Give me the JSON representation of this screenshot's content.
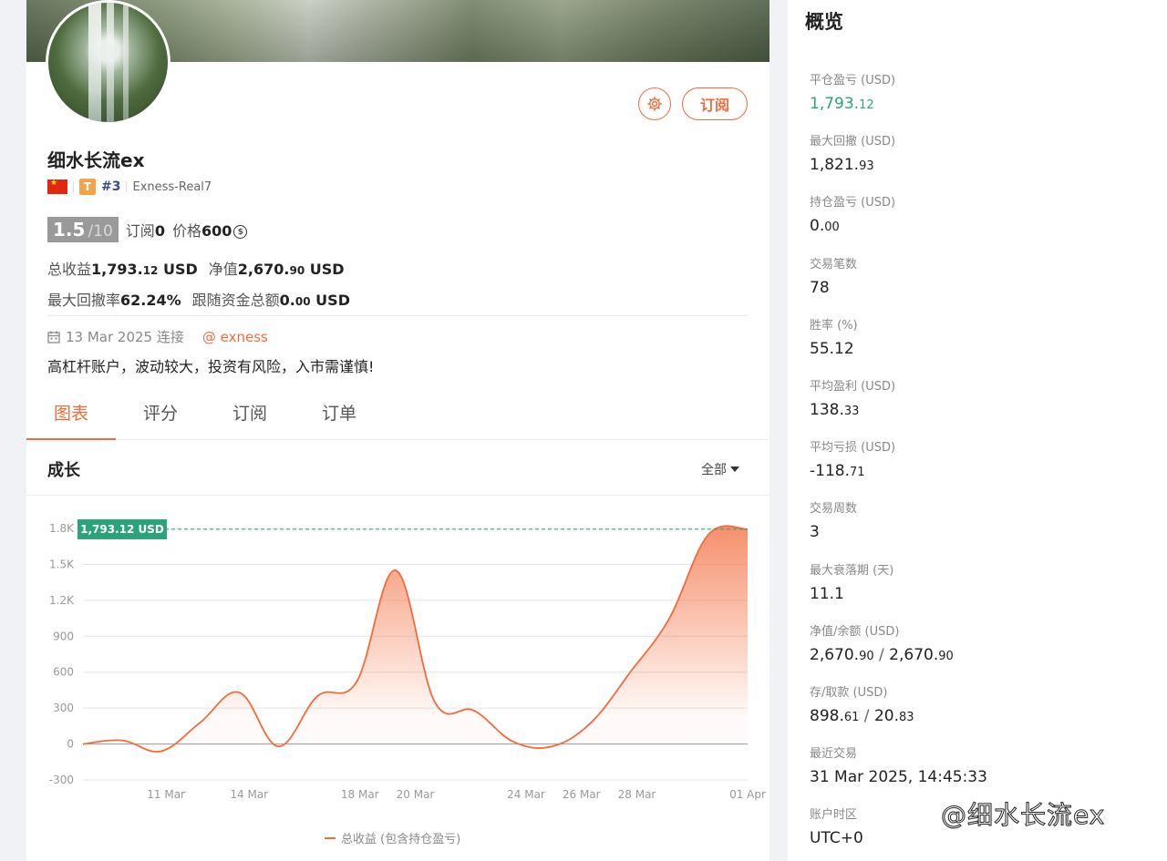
{
  "profile": {
    "name": "细水长流ex",
    "tier_letter": "T",
    "rank": "#3",
    "server": "Exness-Real7",
    "subscribe_label": "订阅",
    "rating_value": "1.5",
    "rating_max": "/10",
    "subs_label": "订阅",
    "subs_count": "0",
    "price_label": "价格",
    "price_value": "600",
    "price_currency_icon": "coin-icon",
    "total_profit_label": "总收益",
    "total_profit_int": "1,793.",
    "total_profit_dec": "12",
    "total_profit_unit": "USD",
    "equity_label": "净值",
    "equity_int": "2,670.",
    "equity_dec": "90",
    "equity_unit": "USD",
    "max_dd_label": "最大回撤率",
    "max_dd_value": "62.24%",
    "follow_funds_label": "跟随资金总额",
    "follow_funds_int": "0.",
    "follow_funds_dec": "00",
    "follow_funds_unit": "USD",
    "connected_date": "13 Mar 2025 连接",
    "broker_link": "@ exness",
    "bio": "高杠杆账户，波动较大，投资有风险，入市需谨慎!"
  },
  "tabs": [
    {
      "label": "图表",
      "active": true
    },
    {
      "label": "评分",
      "active": false
    },
    {
      "label": "订阅",
      "active": false
    },
    {
      "label": "订单",
      "active": false
    }
  ],
  "section": {
    "title": "成长",
    "range_label": "全部"
  },
  "chart_data": {
    "type": "area",
    "title": "成长",
    "x": [
      "08 Mar",
      "09 Mar",
      "10 Mar",
      "11 Mar",
      "12 Mar",
      "13 Mar",
      "14 Mar",
      "15 Mar",
      "16 Mar",
      "17 Mar",
      "18 Mar",
      "19 Mar",
      "20 Mar",
      "21 Mar",
      "22 Mar",
      "23 Mar",
      "24 Mar",
      "25 Mar",
      "26 Mar",
      "27 Mar",
      "28 Mar",
      "29 Mar",
      "30 Mar",
      "31 Mar",
      "01 Apr"
    ],
    "x_ticks": [
      "11 Mar",
      "14 Mar",
      "18 Mar",
      "20 Mar",
      "24 Mar",
      "26 Mar",
      "28 Mar",
      "01 Apr"
    ],
    "y_ticks": [
      "1.8K",
      "1.5K",
      "1.2K",
      "900",
      "600",
      "300",
      "0",
      "-300"
    ],
    "ylim": [
      -300,
      1800
    ],
    "series": [
      {
        "name": "总收益 (包含持仓盈亏)",
        "values": [
          0,
          30,
          -60,
          180,
          430,
          -20,
          400,
          520,
          1450,
          350,
          280,
          20,
          -20,
          180,
          600,
          1050,
          1750,
          1793
        ]
      }
    ],
    "last_value_label": "1,793.12 USD",
    "accent": "#f36b3b",
    "marker_color": "#2aa37a"
  },
  "overview": {
    "title": "概览",
    "items": [
      {
        "label": "平仓盈亏 (USD)",
        "int": "1,793.",
        "dec": "12",
        "green": true
      },
      {
        "label": "最大回撤 (USD)",
        "int": "1,821.",
        "dec": "93"
      },
      {
        "label": "持仓盈亏 (USD)",
        "int": "0.",
        "dec": "00"
      },
      {
        "label": "交易笔数",
        "int": "78",
        "dec": ""
      },
      {
        "label": "胜率 (%)",
        "int": "55.12",
        "dec": ""
      },
      {
        "label": "平均盈利 (USD)",
        "int": "138.",
        "dec": "33"
      },
      {
        "label": "平均亏损 (USD)",
        "int": "-118.",
        "dec": "71"
      },
      {
        "label": "交易周数",
        "int": "3",
        "dec": ""
      },
      {
        "label": "最大衰落期 (天)",
        "int": "11.1",
        "dec": ""
      },
      {
        "label": "净值/余额 (USD)",
        "int": "2,670.",
        "dec": "90",
        "int2": "2,670.",
        "dec2": "90"
      },
      {
        "label": "存/取款 (USD)",
        "int": "898.",
        "dec": "61",
        "int2": "20.",
        "dec2": "83"
      },
      {
        "label": "最近交易",
        "int": "31 Mar 2025, 14:45:33",
        "dec": ""
      },
      {
        "label": "账户时区",
        "int": "UTC+0",
        "dec": ""
      }
    ]
  },
  "watermark": "@细水长流ex"
}
